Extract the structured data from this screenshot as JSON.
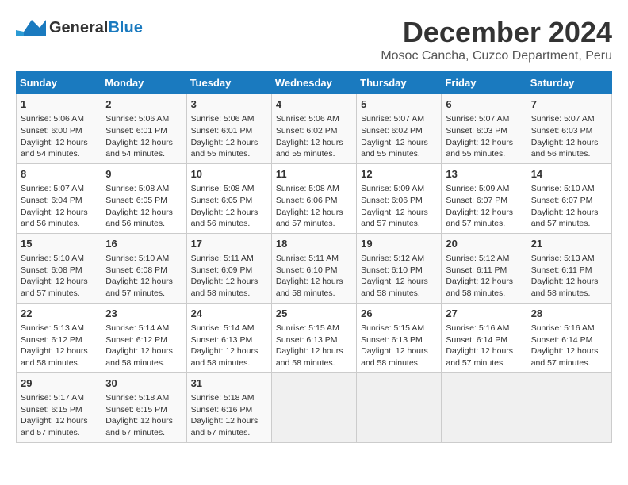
{
  "header": {
    "logo_general": "General",
    "logo_blue": "Blue",
    "title": "December 2024",
    "subtitle": "Mosoc Cancha, Cuzco Department, Peru"
  },
  "calendar": {
    "days_of_week": [
      "Sunday",
      "Monday",
      "Tuesday",
      "Wednesday",
      "Thursday",
      "Friday",
      "Saturday"
    ],
    "weeks": [
      [
        {
          "day": "",
          "empty": true
        },
        {
          "day": "",
          "empty": true
        },
        {
          "day": "",
          "empty": true
        },
        {
          "day": "",
          "empty": true
        },
        {
          "day": "",
          "empty": true
        },
        {
          "day": "",
          "empty": true
        },
        {
          "day": "",
          "empty": true
        }
      ],
      [
        {
          "day": "1",
          "info": "Sunrise: 5:06 AM\nSunset: 6:00 PM\nDaylight: 12 hours\nand 54 minutes."
        },
        {
          "day": "2",
          "info": "Sunrise: 5:06 AM\nSunset: 6:01 PM\nDaylight: 12 hours\nand 54 minutes."
        },
        {
          "day": "3",
          "info": "Sunrise: 5:06 AM\nSunset: 6:01 PM\nDaylight: 12 hours\nand 55 minutes."
        },
        {
          "day": "4",
          "info": "Sunrise: 5:06 AM\nSunset: 6:02 PM\nDaylight: 12 hours\nand 55 minutes."
        },
        {
          "day": "5",
          "info": "Sunrise: 5:07 AM\nSunset: 6:02 PM\nDaylight: 12 hours\nand 55 minutes."
        },
        {
          "day": "6",
          "info": "Sunrise: 5:07 AM\nSunset: 6:03 PM\nDaylight: 12 hours\nand 55 minutes."
        },
        {
          "day": "7",
          "info": "Sunrise: 5:07 AM\nSunset: 6:03 PM\nDaylight: 12 hours\nand 56 minutes."
        }
      ],
      [
        {
          "day": "8",
          "info": "Sunrise: 5:07 AM\nSunset: 6:04 PM\nDaylight: 12 hours\nand 56 minutes."
        },
        {
          "day": "9",
          "info": "Sunrise: 5:08 AM\nSunset: 6:05 PM\nDaylight: 12 hours\nand 56 minutes."
        },
        {
          "day": "10",
          "info": "Sunrise: 5:08 AM\nSunset: 6:05 PM\nDaylight: 12 hours\nand 56 minutes."
        },
        {
          "day": "11",
          "info": "Sunrise: 5:08 AM\nSunset: 6:06 PM\nDaylight: 12 hours\nand 57 minutes."
        },
        {
          "day": "12",
          "info": "Sunrise: 5:09 AM\nSunset: 6:06 PM\nDaylight: 12 hours\nand 57 minutes."
        },
        {
          "day": "13",
          "info": "Sunrise: 5:09 AM\nSunset: 6:07 PM\nDaylight: 12 hours\nand 57 minutes."
        },
        {
          "day": "14",
          "info": "Sunrise: 5:10 AM\nSunset: 6:07 PM\nDaylight: 12 hours\nand 57 minutes."
        }
      ],
      [
        {
          "day": "15",
          "info": "Sunrise: 5:10 AM\nSunset: 6:08 PM\nDaylight: 12 hours\nand 57 minutes."
        },
        {
          "day": "16",
          "info": "Sunrise: 5:10 AM\nSunset: 6:08 PM\nDaylight: 12 hours\nand 57 minutes."
        },
        {
          "day": "17",
          "info": "Sunrise: 5:11 AM\nSunset: 6:09 PM\nDaylight: 12 hours\nand 58 minutes."
        },
        {
          "day": "18",
          "info": "Sunrise: 5:11 AM\nSunset: 6:10 PM\nDaylight: 12 hours\nand 58 minutes."
        },
        {
          "day": "19",
          "info": "Sunrise: 5:12 AM\nSunset: 6:10 PM\nDaylight: 12 hours\nand 58 minutes."
        },
        {
          "day": "20",
          "info": "Sunrise: 5:12 AM\nSunset: 6:11 PM\nDaylight: 12 hours\nand 58 minutes."
        },
        {
          "day": "21",
          "info": "Sunrise: 5:13 AM\nSunset: 6:11 PM\nDaylight: 12 hours\nand 58 minutes."
        }
      ],
      [
        {
          "day": "22",
          "info": "Sunrise: 5:13 AM\nSunset: 6:12 PM\nDaylight: 12 hours\nand 58 minutes."
        },
        {
          "day": "23",
          "info": "Sunrise: 5:14 AM\nSunset: 6:12 PM\nDaylight: 12 hours\nand 58 minutes."
        },
        {
          "day": "24",
          "info": "Sunrise: 5:14 AM\nSunset: 6:13 PM\nDaylight: 12 hours\nand 58 minutes."
        },
        {
          "day": "25",
          "info": "Sunrise: 5:15 AM\nSunset: 6:13 PM\nDaylight: 12 hours\nand 58 minutes."
        },
        {
          "day": "26",
          "info": "Sunrise: 5:15 AM\nSunset: 6:13 PM\nDaylight: 12 hours\nand 58 minutes."
        },
        {
          "day": "27",
          "info": "Sunrise: 5:16 AM\nSunset: 6:14 PM\nDaylight: 12 hours\nand 57 minutes."
        },
        {
          "day": "28",
          "info": "Sunrise: 5:16 AM\nSunset: 6:14 PM\nDaylight: 12 hours\nand 57 minutes."
        }
      ],
      [
        {
          "day": "29",
          "info": "Sunrise: 5:17 AM\nSunset: 6:15 PM\nDaylight: 12 hours\nand 57 minutes."
        },
        {
          "day": "30",
          "info": "Sunrise: 5:18 AM\nSunset: 6:15 PM\nDaylight: 12 hours\nand 57 minutes."
        },
        {
          "day": "31",
          "info": "Sunrise: 5:18 AM\nSunset: 6:16 PM\nDaylight: 12 hours\nand 57 minutes."
        },
        {
          "day": "",
          "empty": true
        },
        {
          "day": "",
          "empty": true
        },
        {
          "day": "",
          "empty": true
        },
        {
          "day": "",
          "empty": true
        }
      ]
    ]
  }
}
